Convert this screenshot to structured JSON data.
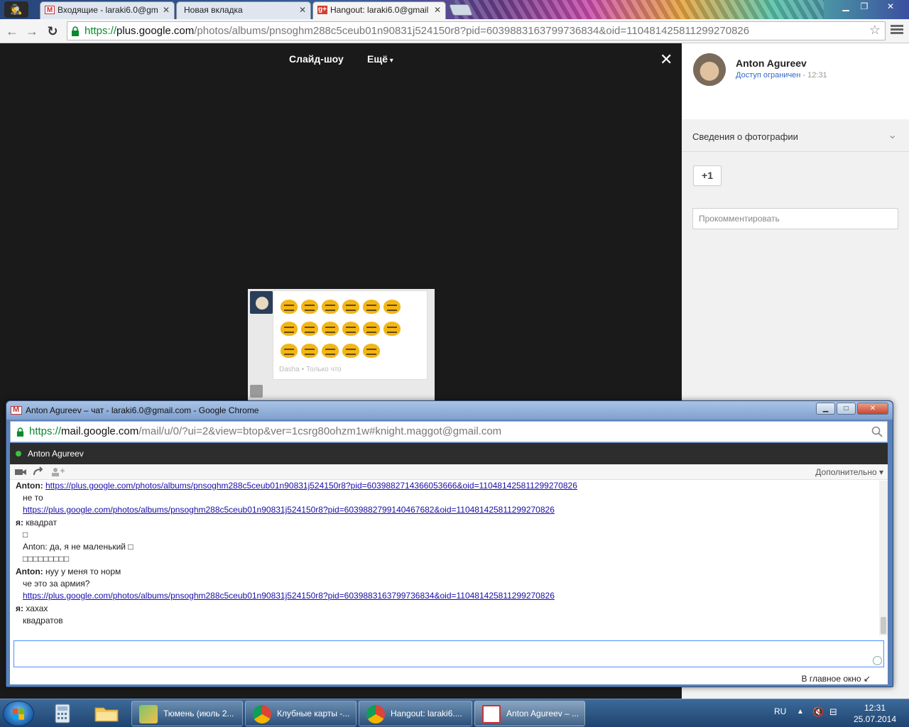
{
  "browser": {
    "tabs": [
      {
        "label": "Входящие - laraki6.0@gm",
        "favicon": "gmail-icon"
      },
      {
        "label": "Новая вкладка",
        "favicon": "none"
      },
      {
        "label": "Hangout: laraki6.0@gmail",
        "favicon": "google-plus-icon"
      }
    ],
    "url_scheme": "https://",
    "url_host": "plus.google.com",
    "url_path": "/photos/albums/pnsoghm288c5ceub01n90831j524150r8?pid=6039883163799736834&oid=110481425811299270826"
  },
  "viewer": {
    "slideshow_label": "Слайд-шоу",
    "more_label": "Ещё",
    "close_glyph": "✕",
    "photo_meta": "Dasha • Только что"
  },
  "sidebar": {
    "owner_name": "Anton Agureev",
    "access_label": "Доступ ограничен",
    "access_time": " - 12:31",
    "info_label": "Сведения о фотографии",
    "plus_one": "+1",
    "comment_placeholder": "Прокомментировать"
  },
  "chat_window": {
    "title": "Anton Agureev – чат - laraki6.0@gmail.com - Google Chrome",
    "url_scheme": "https://",
    "url_host": "mail.google.com",
    "url_path": "/mail/u/0/?ui=2&view=btop&ver=1csrg80ohzm1w#knight.maggot@gmail.com",
    "contact_name": "Anton Agureev",
    "more_label": "Дополнительно ▾",
    "popin_label": "В главное окно",
    "messages": [
      {
        "speaker": "Anton:",
        "text": "",
        "link": "https://plus.google.com/photos/albums/pnsoghm288c5ceub01n90831j524150r8?pid=6039882714366053666&oid=110481425811299270826"
      },
      {
        "speaker": "",
        "text": "не то",
        "link": ""
      },
      {
        "speaker": "",
        "text": "",
        "link": "https://plus.google.com/photos/albums/pnsoghm288c5ceub01n90831j524150r8?pid=6039882799140467682&oid=110481425811299270826"
      },
      {
        "speaker": "я:",
        "text": "квадрат",
        "link": ""
      },
      {
        "speaker": "",
        "text": "□",
        "link": ""
      },
      {
        "speaker": "",
        "text": "Anton:  да, я не маленький □",
        "link": ""
      },
      {
        "speaker": "",
        "text": "□□□□□□□□□",
        "link": ""
      },
      {
        "speaker": "Anton:",
        "text": "нуу у меня то норм",
        "link": ""
      },
      {
        "speaker": "",
        "text": "че это за армия?",
        "link": ""
      },
      {
        "speaker": "",
        "text": "",
        "link": "https://plus.google.com/photos/albums/pnsoghm288c5ceub01n90831j524150r8?pid=6039883163799736834&oid=110481425811299270826"
      },
      {
        "speaker": "я:",
        "text": "хахах",
        "link": ""
      },
      {
        "speaker": "",
        "text": "квадратов",
        "link": ""
      }
    ]
  },
  "taskbar": {
    "buttons": [
      {
        "label": "Тюмень (июль 2...",
        "icon": "map-icon"
      },
      {
        "label": "Клубные карты -...",
        "icon": "chrome-icon"
      },
      {
        "label": "Hangout: laraki6....",
        "icon": "chrome-icon"
      },
      {
        "label": "Anton Agureev – ...",
        "icon": "gmail-icon"
      }
    ],
    "language": "RU",
    "time": "12:31",
    "date": "25.07.2014"
  },
  "colors": {
    "chrome_green": "#0a8a2e",
    "link_blue": "#3366cc",
    "emoji_yellow": "#f2b616",
    "online_green": "#3ac43a"
  }
}
